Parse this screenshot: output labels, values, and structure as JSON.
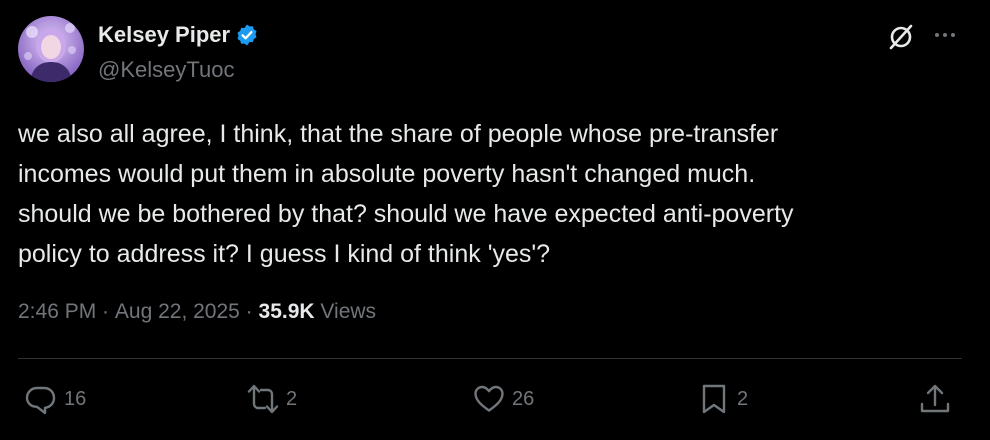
{
  "author": {
    "name": "Kelsey Piper",
    "handle": "@KelseyTuoc",
    "verified_icon": "verified-badge-icon",
    "accent": "#1d9bf0"
  },
  "header_icons": {
    "grok": "grok-icon",
    "more": "more-icon"
  },
  "tweet": {
    "text": "we also all agree, I think, that the share of people whose pre-transfer\nincomes would put them in absolute poverty hasn't changed much.\nshould we be bothered by that? should we have expected anti-poverty\npolicy to address it? I guess I kind of think 'yes'?"
  },
  "meta": {
    "time": "2:46 PM",
    "separator": " · ",
    "date": "Aug 22, 2025",
    "views_count": "35.9K",
    "views_label": " Views"
  },
  "actions": {
    "reply": {
      "icon": "reply-icon",
      "count": "16"
    },
    "retweet": {
      "icon": "retweet-icon",
      "count": "2"
    },
    "like": {
      "icon": "heart-icon",
      "count": "26"
    },
    "bookmark": {
      "icon": "bookmark-icon",
      "count": "2"
    },
    "share": {
      "icon": "share-icon"
    }
  },
  "colors": {
    "background": "#000000",
    "text": "#e7e9ea",
    "secondary": "#71767b",
    "divider": "#2f3336"
  }
}
